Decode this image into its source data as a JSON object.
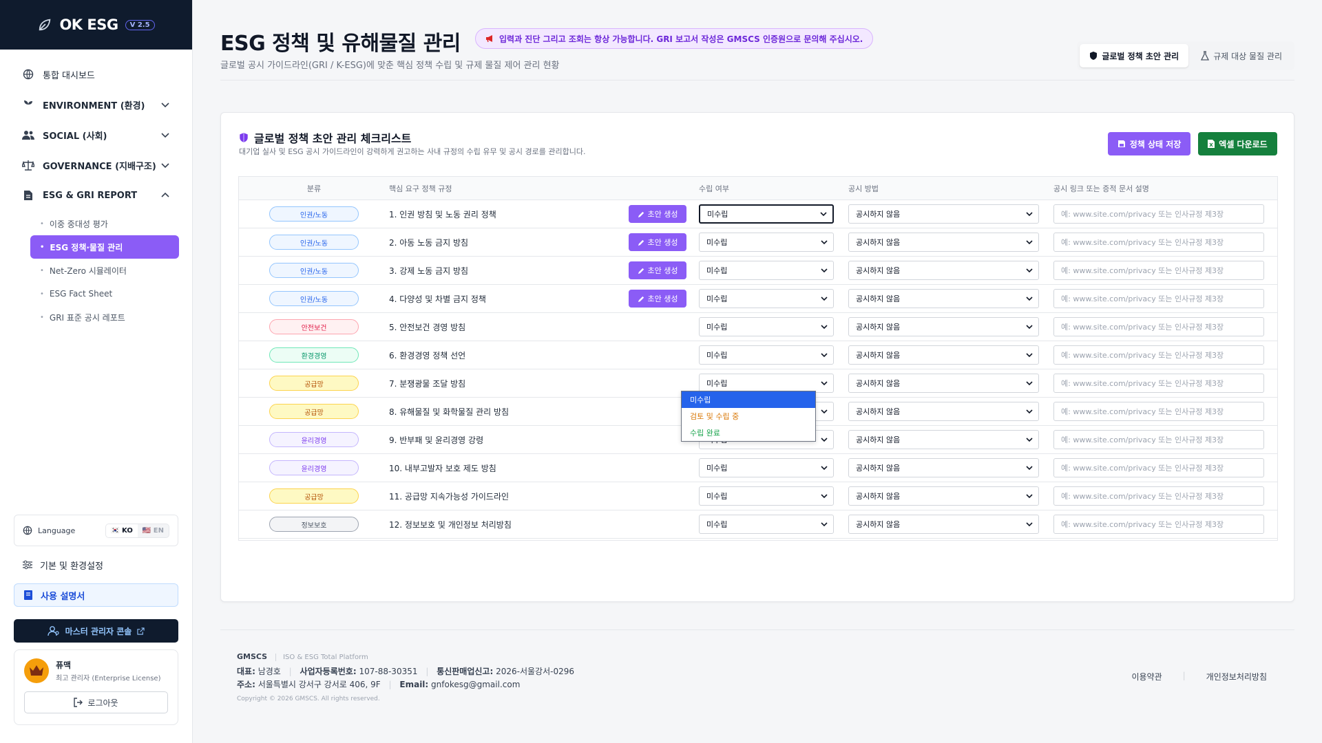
{
  "brand": {
    "name": "OK ESG",
    "version": "V 2.5"
  },
  "nav": {
    "dashboard": "통합 대시보드",
    "environment": "ENVIRONMENT (환경)",
    "social": "SOCIAL (사회)",
    "governance": "GOVERNANCE (지배구조)",
    "report": "ESG & GRI REPORT",
    "sub": [
      "이중 중대성 평가",
      "ESG 정책·물질 관리",
      "Net-Zero 시뮬레이터",
      "ESG Fact Sheet",
      "GRI 표준 공시 레포트"
    ]
  },
  "sidebar_bottom": {
    "language_label": "Language",
    "lang_ko": "🇰🇷 KO",
    "lang_en": "🇺🇸 EN",
    "settings": "기본 및 환경설정",
    "guide": "사용 설명서",
    "master": "마스터 관리자 콘솔",
    "profile_name": "퓨맥",
    "profile_role": "최고 관리자 (Enterprise License)",
    "logout": "로그아웃"
  },
  "header": {
    "title": "ESG 정책 및 유해물질 관리",
    "notice": "입력과 진단 그리고 조회는 항상 가능합니다. GRI 보고서 작성은 GMSCS 인증원으로 문의해 주십시오.",
    "subtitle": "글로벌 공시 가이드라인(GRI / K-ESG)에 맞춘 핵심 정책 수립 및 규제 물질 제어 관리 현황",
    "tab_policy": "글로벌 정책 초안 관리",
    "tab_material": "규제 대상 물질 관리"
  },
  "card": {
    "title": "글로벌 정책 초안 관리 체크리스트",
    "subtitle": "대기업 실사 및 ESG 공시 가이드라인이 강력하게 권고하는 사내 규정의 수립 유무 및 공시 경로를 관리합니다.",
    "save_btn": "정책 상태 저장",
    "excel_btn": "엑셀 다운로드"
  },
  "table": {
    "headers": [
      "분류",
      "핵심 요구 정책 규정",
      "수립 여부",
      "공시 방법",
      "공시 링크 또는 증적 문서 설명"
    ],
    "draft_label": "초안 생성",
    "status_default": "미수립",
    "disclosure_default": "공시하지 않음",
    "link_placeholder": "예: www.site.com/privacy 또는 인사규정 제3장",
    "rows": [
      {
        "cat": "인권/노동",
        "cls": "hr-labor",
        "policy": "1. 인권 방침 및 노동 권리 정책",
        "draft": true
      },
      {
        "cat": "인권/노동",
        "cls": "hr-labor",
        "policy": "2. 아동 노동 금지 방침",
        "draft": true
      },
      {
        "cat": "인권/노동",
        "cls": "hr-labor",
        "policy": "3. 강제 노동 금지 방침",
        "draft": true
      },
      {
        "cat": "인권/노동",
        "cls": "hr-labor",
        "policy": "4. 다양성 및 차별 금지 정책",
        "draft": true
      },
      {
        "cat": "안전보건",
        "cls": "safety",
        "policy": "5. 안전보건 경영 방침",
        "draft": false
      },
      {
        "cat": "환경경영",
        "cls": "env",
        "policy": "6. 환경경영 정책 선언",
        "draft": false
      },
      {
        "cat": "공급망",
        "cls": "supply",
        "policy": "7. 분쟁광물 조달 방침",
        "draft": false
      },
      {
        "cat": "공급망",
        "cls": "supply",
        "policy": "8. 유해물질 및 화학물질 관리 방침",
        "draft": false
      },
      {
        "cat": "윤리경영",
        "cls": "ethics",
        "policy": "9. 반부패 및 윤리경영 강령",
        "draft": false
      },
      {
        "cat": "윤리경영",
        "cls": "ethics",
        "policy": "10. 내부고발자 보호 제도 방침",
        "draft": false
      },
      {
        "cat": "공급망",
        "cls": "supply",
        "policy": "11. 공급망 지속가능성 가이드라인",
        "draft": false
      },
      {
        "cat": "정보보호",
        "cls": "privacy",
        "policy": "12. 정보보호 및 개인정보 처리방침",
        "draft": false
      }
    ],
    "dropdown_options": [
      "미수립",
      "검토 및 수립 중",
      "수립 완료"
    ]
  },
  "footer": {
    "company": "GMSCS",
    "tagline": "ISO & ESG Total Platform",
    "rep_label": "대표:",
    "rep": "남경호",
    "biz_label": "사업자등록번호:",
    "biz": "107-88-30351",
    "sales_label": "통신판매업신고:",
    "sales": "2026-서울강서-0296",
    "addr_label": "주소:",
    "addr": "서울특별시 강서구 강서로 406, 9F",
    "email_label": "Email:",
    "email": "gnfokesg@gmail.com",
    "copyright": "Copyright © 2026 GMSCS. All rights reserved.",
    "terms": "이용약관",
    "privacy": "개인정보처리방침"
  },
  "colors": {
    "accent": "#8b5cf6",
    "excel": "#15803d",
    "sidebar_dark": "#0f1b2d"
  }
}
